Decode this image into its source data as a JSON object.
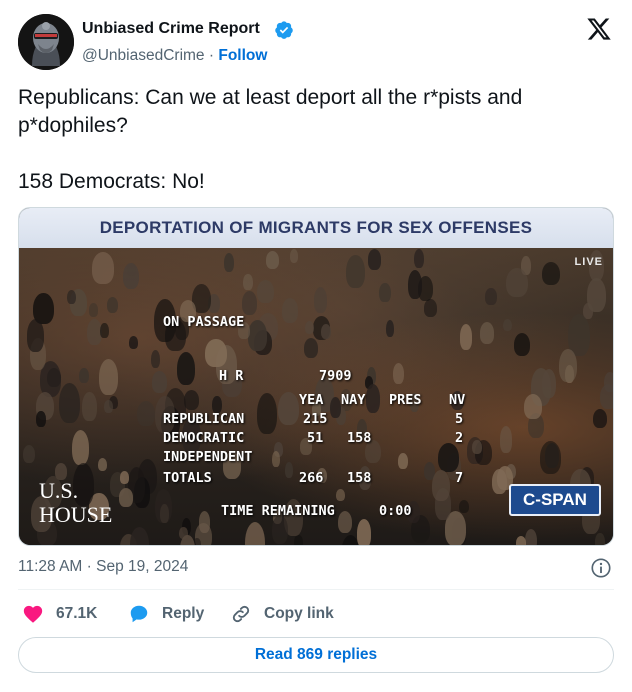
{
  "author": {
    "name": "Unbiased Crime Report",
    "handle": "@UnbiasedCrime",
    "separator": "·",
    "follow_label": "Follow"
  },
  "tweet": {
    "text": "Republicans: Can we at least deport all the r*pists and p*dophiles?\n\n158 Democrats: No!"
  },
  "media": {
    "banner_title": "DEPORTATION OF MIGRANTS FOR SEX OFFENSES",
    "live_label": "LIVE",
    "board": {
      "on_passage": "ON PASSAGE",
      "hr_label": "H R",
      "hr_number": "7909",
      "col_yea": "YEA",
      "col_nay": "NAY",
      "col_pres": "PRES",
      "col_nv": "NV",
      "rows": [
        {
          "party": "REPUBLICAN",
          "yea": "215",
          "nay": "",
          "nv": "5"
        },
        {
          "party": "DEMOCRATIC",
          "yea": "51",
          "nay": "158",
          "nv": "2"
        },
        {
          "party": "INDEPENDENT",
          "yea": "",
          "nay": "",
          "nv": ""
        },
        {
          "party": "TOTALS",
          "yea": "266",
          "nay": "158",
          "nv": "7"
        }
      ],
      "time_remaining_label": "TIME REMAINING",
      "time_remaining_value": "0:00"
    },
    "house_logo_line1": "U.S.",
    "house_logo_line2": "HOUSE",
    "cspan_logo": "C-SPAN"
  },
  "timestamp": "11:28 AM · Sep 19, 2024",
  "actions": {
    "likes": "67.1K",
    "reply_label": "Reply",
    "copy_link_label": "Copy link"
  },
  "read_replies_label": "Read 869 replies",
  "colors": {
    "link_blue": "#006fd6",
    "heart_red": "#f91880",
    "reply_blue": "#1d9bf0",
    "verified_blue": "#1d9bf0",
    "muted_gray": "#536471"
  }
}
